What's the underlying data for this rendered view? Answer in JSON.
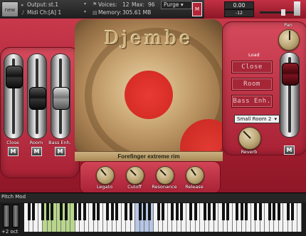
{
  "header": {
    "logo_text": "new",
    "output_label": "Output:",
    "output_value": "st.1",
    "midi_label": "Midi Ch:",
    "midi_value": "[A] 1",
    "voices_label": "Voices:",
    "voices_value": "12",
    "max_label": "Max:",
    "max_value": "96",
    "memory_label": "Memory:",
    "memory_value": "305.61 MB",
    "purge_label": "Purge",
    "m_label": "M",
    "counter_value": "0.00",
    "counter_small": "-12"
  },
  "drum": {
    "title": "Djembe",
    "status": "Forefinger extreme rim"
  },
  "left_faders": [
    {
      "label": "Close",
      "m": "M"
    },
    {
      "label": "Room",
      "m": "M"
    },
    {
      "label": "Bass Enh.",
      "m": "M"
    }
  ],
  "right_panel": {
    "pan_label": "Pan",
    "load_label": "Load",
    "buttons": [
      "Close",
      "Room",
      "Bass Enh."
    ],
    "room_preset": "Small Room 2",
    "reverb_label": "Reverb",
    "m_label": "M"
  },
  "bottom_knobs": [
    {
      "label": "Legato"
    },
    {
      "label": "Cutoff"
    },
    {
      "label": "Resonance"
    },
    {
      "label": "Release"
    }
  ],
  "keyboard": {
    "pitch_mod_label": "Pitch Mod",
    "octave_label": "+2 oct"
  }
}
